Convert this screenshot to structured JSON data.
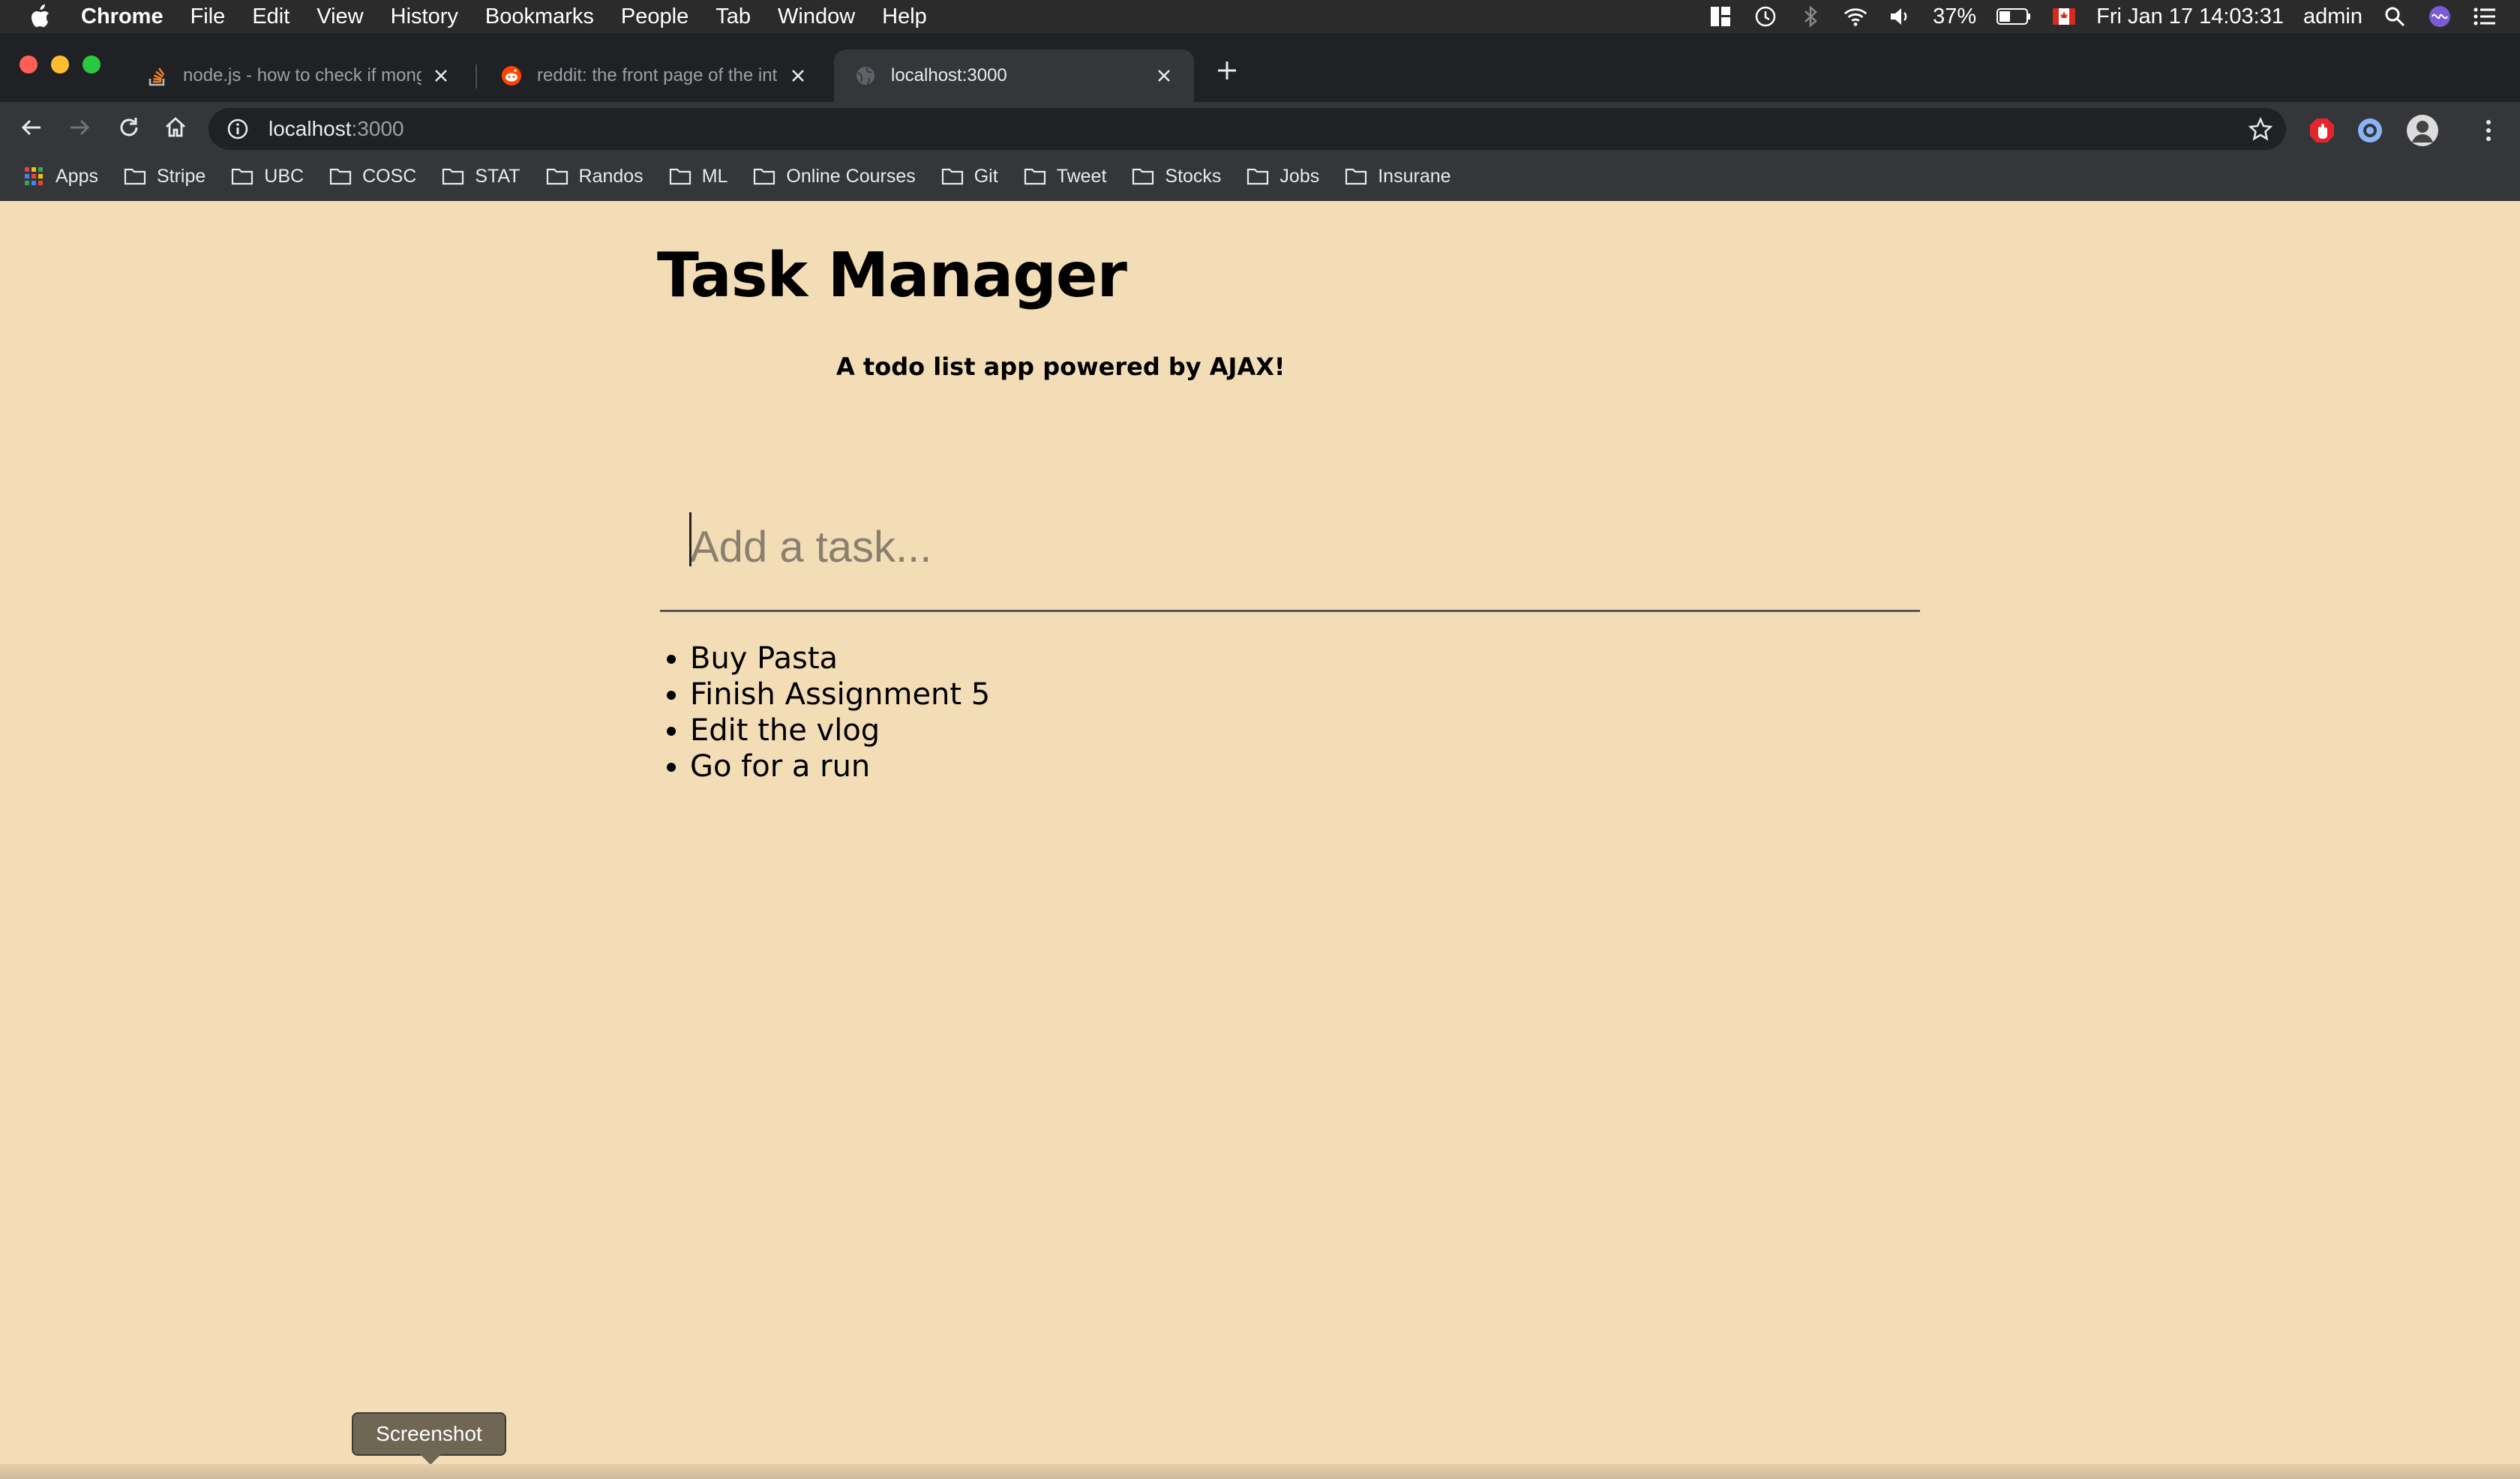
{
  "menubar": {
    "app_name": "Chrome",
    "items": [
      "File",
      "Edit",
      "View",
      "History",
      "Bookmarks",
      "People",
      "Tab",
      "Window",
      "Help"
    ],
    "battery": "37%",
    "datetime": "Fri Jan 17  14:03:31",
    "user": "admin"
  },
  "tabs": [
    {
      "title": "node.js - how to check if mong",
      "icon": "stackoverflow-icon",
      "active": false
    },
    {
      "title": "reddit: the front page of the int",
      "icon": "reddit-icon",
      "active": false
    },
    {
      "title": "localhost:3000",
      "icon": "globe-icon",
      "active": true
    }
  ],
  "omnibox": {
    "host": "localhost",
    "port": ":3000"
  },
  "bookmarks": [
    "Apps",
    "Stripe",
    "UBC",
    "COSC",
    "STAT",
    "Randos",
    "ML",
    "Online Courses",
    "Git",
    "Tweet",
    "Stocks",
    "Jobs",
    "Insurane"
  ],
  "page": {
    "title": "Task Manager",
    "subtitle": "A todo list app powered by AJAX!",
    "input_placeholder": "Add a task...",
    "tasks": [
      "Buy Pasta",
      "Finish Assignment 5",
      "Edit the vlog",
      "Go for a run"
    ]
  },
  "dock": {
    "tooltip": "Screenshot"
  },
  "colors": {
    "page_bg": "#f3ddb6",
    "menubar_bg": "#2b2b2b",
    "tabstrip_bg": "#202124",
    "toolbar_bg": "#35363a"
  }
}
